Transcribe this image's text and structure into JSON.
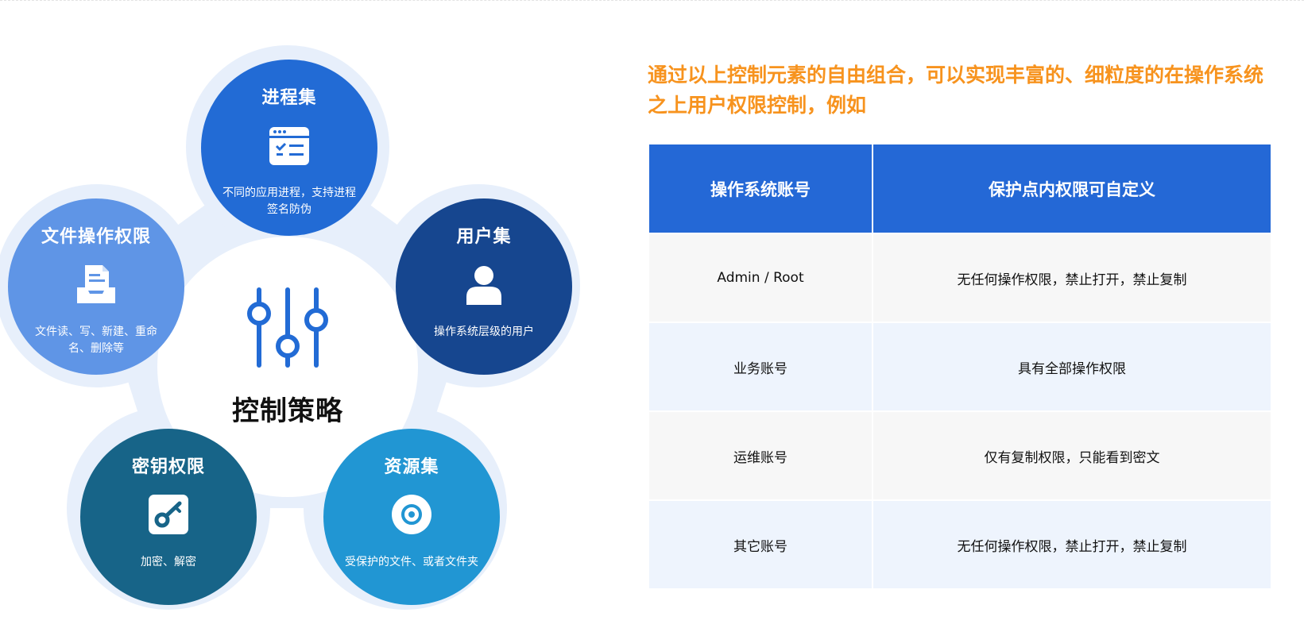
{
  "diagram": {
    "center_title": "控制策略",
    "nodes": [
      {
        "title": "进程集",
        "icon": "app-window-checklist-icon",
        "desc": "不同的应用进程，支持进程签名防伪",
        "color": "#226bd5"
      },
      {
        "title": "用户集",
        "icon": "user-icon",
        "desc": "操作系统层级的用户",
        "color": "#16468f"
      },
      {
        "title": "资源集",
        "icon": "disc-icon",
        "desc": "受保护的文件、或者文件夹",
        "color": "#2196d3"
      },
      {
        "title": "密钥权限",
        "icon": "key-icon",
        "desc": "加密、解密",
        "color": "#176488"
      },
      {
        "title": "文件操作权限",
        "icon": "document-tray-icon",
        "desc": "文件读、写、新建、重命名、删除等",
        "color": "#5f95e6"
      }
    ]
  },
  "headline": "通过以上控制元素的自由组合，可以实现丰富的、细粒度的在操作系统之上用户权限控制，例如",
  "table": {
    "headers": [
      "操作系统账号",
      "保护点内权限可自定义"
    ],
    "rows": [
      [
        "Admin / Root",
        "无任何操作权限，禁止打开，禁止复制"
      ],
      [
        "业务账号",
        "具有全部操作权限"
      ],
      [
        "运维账号",
        "仅有复制权限，只能看到密文"
      ],
      [
        "其它账号",
        "无任何操作权限，禁止打开，禁止复制"
      ]
    ]
  },
  "colors": {
    "accent": "#2468d6",
    "headline": "#f7931e",
    "flower_bg": "#e7effb"
  }
}
